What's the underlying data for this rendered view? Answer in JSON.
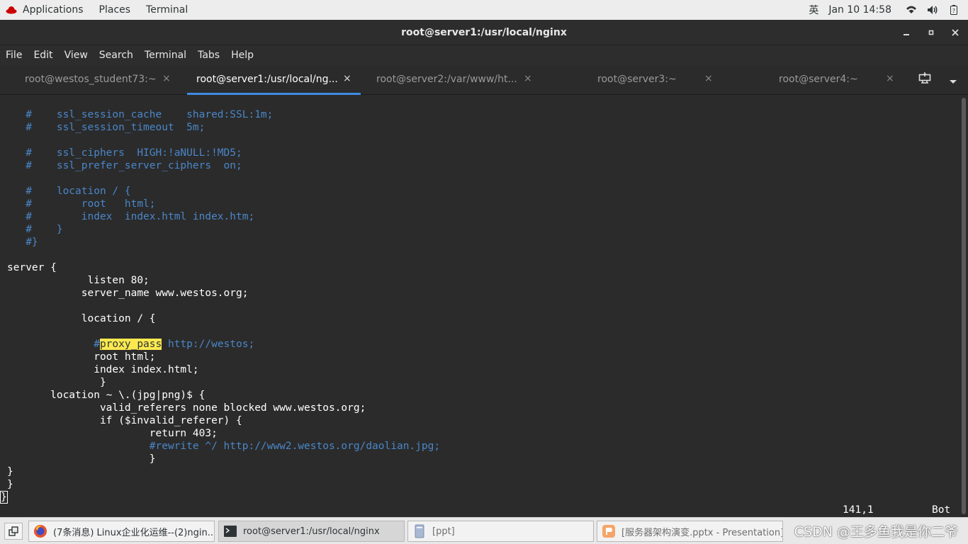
{
  "topbar": {
    "applications": "Applications",
    "places": "Places",
    "terminal": "Terminal",
    "input_method": "英",
    "datetime": "Jan 10  14:58",
    "icons": [
      "wifi-icon",
      "volume-icon",
      "battery-icon"
    ]
  },
  "window": {
    "title": "root@server1:/usr/local/nginx",
    "controls": [
      "minimize-icon",
      "maximize-icon",
      "close-icon"
    ]
  },
  "menubar": [
    "File",
    "Edit",
    "View",
    "Search",
    "Terminal",
    "Tabs",
    "Help"
  ],
  "tabs": [
    {
      "label": "root@westos_student73:~",
      "active": false
    },
    {
      "label": "root@server1:/usr/local/ng...",
      "active": true
    },
    {
      "label": "root@server2:/var/www/ht...",
      "active": false
    },
    {
      "label": "root@server3:~",
      "active": false
    },
    {
      "label": "root@server4:~",
      "active": false
    }
  ],
  "tab_close": "×",
  "terminal": {
    "lines": [
      {
        "text": "   #    ssl_session_cache    shared:SSL:1m;",
        "type": "comment"
      },
      {
        "text": "   #    ssl_session_timeout  5m;",
        "type": "comment"
      },
      {
        "text": "",
        "type": "blank"
      },
      {
        "text": "   #    ssl_ciphers  HIGH:!aNULL:!MD5;",
        "type": "comment"
      },
      {
        "text": "   #    ssl_prefer_server_ciphers  on;",
        "type": "comment"
      },
      {
        "text": "",
        "type": "blank"
      },
      {
        "text": "   #    location / {",
        "type": "comment"
      },
      {
        "text": "   #        root   html;",
        "type": "comment"
      },
      {
        "text": "   #        index  index.html index.htm;",
        "type": "comment"
      },
      {
        "text": "   #    }",
        "type": "comment"
      },
      {
        "text": "   #}",
        "type": "comment"
      },
      {
        "text": "",
        "type": "blank"
      },
      {
        "text": "server {",
        "type": "code"
      },
      {
        "text": "             listen 80;",
        "type": "code"
      },
      {
        "text": "            server_name www.westos.org;",
        "type": "code"
      },
      {
        "text": "",
        "type": "blank"
      },
      {
        "text": "            location / {",
        "type": "code"
      },
      {
        "text": "",
        "type": "blank"
      },
      {
        "text": "proxy_pass",
        "type": "highlight",
        "pre": "              #",
        "post": " http://westos;"
      },
      {
        "text": "              root html;",
        "type": "code"
      },
      {
        "text": "              index index.html;",
        "type": "code"
      },
      {
        "text": "               }",
        "type": "code"
      },
      {
        "text": "       location ~ \\.(jpg|png)$ {",
        "type": "code"
      },
      {
        "text": "               valid_referers none blocked www.westos.org;",
        "type": "code"
      },
      {
        "text": "               if ($invalid_referer) {",
        "type": "code"
      },
      {
        "text": "                       return 403;",
        "type": "code"
      },
      {
        "text": "                       #rewrite ^/ http://www2.westos.org/daolian.jpg;",
        "type": "comment"
      },
      {
        "text": "                       }",
        "type": "code"
      },
      {
        "text": "}",
        "type": "code"
      },
      {
        "text": "}",
        "type": "code"
      },
      {
        "text": "}",
        "type": "cursor"
      }
    ],
    "status_position": "141,1",
    "status_scroll": "Bot"
  },
  "taskbar": {
    "items": [
      {
        "label": "(7条消息) Linux企业化运维--(2)ngin...",
        "icon": "firefox-icon",
        "active": false
      },
      {
        "label": "root@server1:/usr/local/nginx",
        "icon": "terminal-icon",
        "active": true
      },
      {
        "label": "[ppt]",
        "icon": "file-icon",
        "active": false
      },
      {
        "label": "[服务器架构演变.pptx - Presentation]",
        "icon": "presentation-icon",
        "active": false
      }
    ],
    "watermark": "CSDN @王多鱼我是你二爷"
  },
  "colors": {
    "comment": "#4a86c8",
    "highlight": "#fce94f",
    "tab_underline": "#3f8ae2",
    "terminal_bg": "#2b2b2b"
  }
}
